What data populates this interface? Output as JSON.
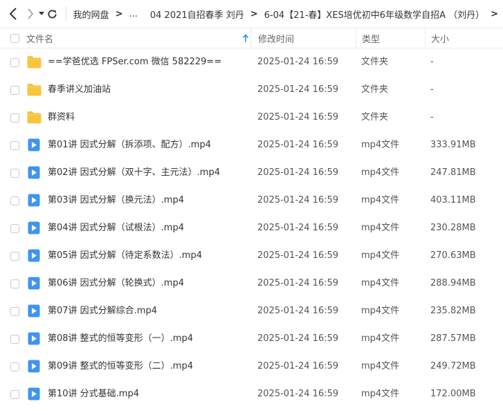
{
  "breadcrumb": {
    "items": [
      "我的网盘",
      "...",
      "04 2021自招春季 刘丹",
      "6-04【21-春】XES培优初中6年级数学自招A （刘丹）"
    ],
    "separator": ">"
  },
  "table": {
    "headers": {
      "name": "文件名",
      "mtime": "修改时间",
      "type": "类型",
      "size": "大小"
    },
    "sort_column": "name",
    "rows": [
      {
        "icon": "folder-icon",
        "name": "==学爸优选 FPSer.com 微信 582229==",
        "mtime": "2025-01-24 16:59",
        "type": "文件夹",
        "size": "-"
      },
      {
        "icon": "folder-icon",
        "name": "春季讲义加油站",
        "mtime": "2025-01-24 16:59",
        "type": "文件夹",
        "size": "-"
      },
      {
        "icon": "folder-icon",
        "name": "群资料",
        "mtime": "2025-01-24 16:59",
        "type": "文件夹",
        "size": "-"
      },
      {
        "icon": "video-file-icon",
        "name": "第01讲 因式分解（拆添项、配方）.mp4",
        "mtime": "2025-01-24 16:59",
        "type": "mp4文件",
        "size": "333.91MB"
      },
      {
        "icon": "video-file-icon",
        "name": "第02讲 因式分解（双十字、主元法）.mp4",
        "mtime": "2025-01-24 16:59",
        "type": "mp4文件",
        "size": "247.81MB"
      },
      {
        "icon": "video-file-icon",
        "name": "第03讲 因式分解（换元法）.mp4",
        "mtime": "2025-01-24 16:59",
        "type": "mp4文件",
        "size": "403.11MB"
      },
      {
        "icon": "video-file-icon",
        "name": "第04讲 因式分解（试根法）.mp4",
        "mtime": "2025-01-24 16:59",
        "type": "mp4文件",
        "size": "230.28MB"
      },
      {
        "icon": "video-file-icon",
        "name": "第05讲 因式分解（待定系数法）.mp4",
        "mtime": "2025-01-24 16:59",
        "type": "mp4文件",
        "size": "270.63MB"
      },
      {
        "icon": "video-file-icon",
        "name": "第06讲 因式分解（轮换式）.mp4",
        "mtime": "2025-01-24 16:59",
        "type": "mp4文件",
        "size": "288.94MB"
      },
      {
        "icon": "video-file-icon",
        "name": "第07讲 因式分解综合.mp4",
        "mtime": "2025-01-24 16:59",
        "type": "mp4文件",
        "size": "235.82MB"
      },
      {
        "icon": "video-file-icon",
        "name": "第08讲 整式的恒等变形（一）.mp4",
        "mtime": "2025-01-24 16:59",
        "type": "mp4文件",
        "size": "287.57MB"
      },
      {
        "icon": "video-file-icon",
        "name": "第09讲 整式的恒等变形（二）.mp4",
        "mtime": "2025-01-24 16:59",
        "type": "mp4文件",
        "size": "249.72MB"
      },
      {
        "icon": "video-file-icon",
        "name": "第10讲 分式基础.mp4",
        "mtime": "2025-01-24 16:59",
        "type": "mp4文件",
        "size": "172.00MB"
      }
    ]
  },
  "colors": {
    "folder": "#F9C33D",
    "video": "#3E94F1",
    "sort_arrow": "#2E86F0"
  }
}
